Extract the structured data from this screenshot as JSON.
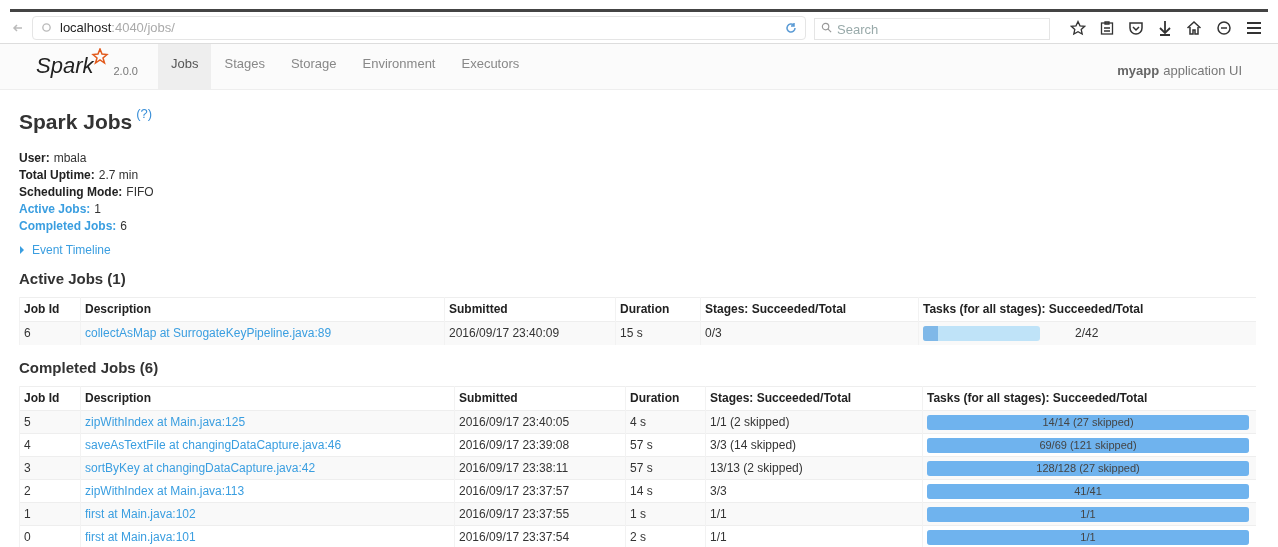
{
  "browser": {
    "url_host": "localhost",
    "url_path": ":4040/jobs/",
    "search_placeholder": "Search"
  },
  "nav": {
    "product": "Spark",
    "version": "2.0.0",
    "tabs": [
      {
        "label": "Jobs",
        "selected": true
      },
      {
        "label": "Stages",
        "selected": false
      },
      {
        "label": "Storage",
        "selected": false
      },
      {
        "label": "Environment",
        "selected": false
      },
      {
        "label": "Executors",
        "selected": false
      }
    ],
    "app_name": "myapp",
    "app_suffix": "application UI"
  },
  "page": {
    "title": "Spark Jobs",
    "help": "(?)",
    "summary": [
      {
        "label": "User:",
        "value": "mbala",
        "kind": "plain"
      },
      {
        "label": "Total Uptime:",
        "value": "2.7 min",
        "kind": "plain"
      },
      {
        "label": "Scheduling Mode:",
        "value": "FIFO",
        "kind": "plain"
      },
      {
        "label": "Active Jobs:",
        "value": "1",
        "kind": "link"
      },
      {
        "label": "Completed Jobs:",
        "value": "6",
        "kind": "link"
      }
    ],
    "timeline": {
      "label": "Event Timeline",
      "expanded": false
    }
  },
  "active_jobs": {
    "title": "Active Jobs (1)",
    "columns": [
      "Job Id",
      "Description",
      "Submitted",
      "Duration",
      "Stages: Succeeded/Total",
      "Tasks (for all stages): Succeeded/Total"
    ],
    "rows": [
      {
        "id": "6",
        "description": "collectAsMap at SurrogateKeyPipeline.java:89",
        "submitted": "2016/09/17 23:40:09",
        "duration": "15 s",
        "stages": "0/3",
        "tasks": "2/42",
        "level": 0.13
      }
    ]
  },
  "completed_jobs": {
    "title": "Completed Jobs (6)",
    "columns": [
      "Job Id",
      "Description",
      "Submitted",
      "Duration",
      "Stages: Succeeded/Total",
      "Tasks (for all stages): Succeeded/Total"
    ],
    "rows": [
      {
        "id": "5",
        "description": "zipWithIndex at Main.java:125",
        "submitted": "2016/09/17 23:40:05",
        "duration": "4 s",
        "stages": "1/1 (2 skipped)",
        "tasks": "14/14 (27 skipped)",
        "level": 1
      },
      {
        "id": "4",
        "description": "saveAsTextFile at changingDataCapture.java:46",
        "submitted": "2016/09/17 23:39:08",
        "duration": "57 s",
        "stages": "3/3 (14 skipped)",
        "tasks": "69/69 (121 skipped)",
        "level": 1
      },
      {
        "id": "3",
        "description": "sortByKey at changingDataCapture.java:42",
        "submitted": "2016/09/17 23:38:11",
        "duration": "57 s",
        "stages": "13/13 (2 skipped)",
        "tasks": "128/128 (27 skipped)",
        "level": 1
      },
      {
        "id": "2",
        "description": "zipWithIndex at Main.java:113",
        "submitted": "2016/09/17 23:37:57",
        "duration": "14 s",
        "stages": "3/3",
        "tasks": "41/41",
        "level": 1
      },
      {
        "id": "1",
        "description": "first at Main.java:102",
        "submitted": "2016/09/17 23:37:55",
        "duration": "1 s",
        "stages": "1/1",
        "tasks": "1/1",
        "level": 1
      },
      {
        "id": "0",
        "description": "first at Main.java:101",
        "submitted": "2016/09/17 23:37:54",
        "duration": "2 s",
        "stages": "1/1",
        "tasks": "1/1",
        "level": 1
      }
    ]
  }
}
